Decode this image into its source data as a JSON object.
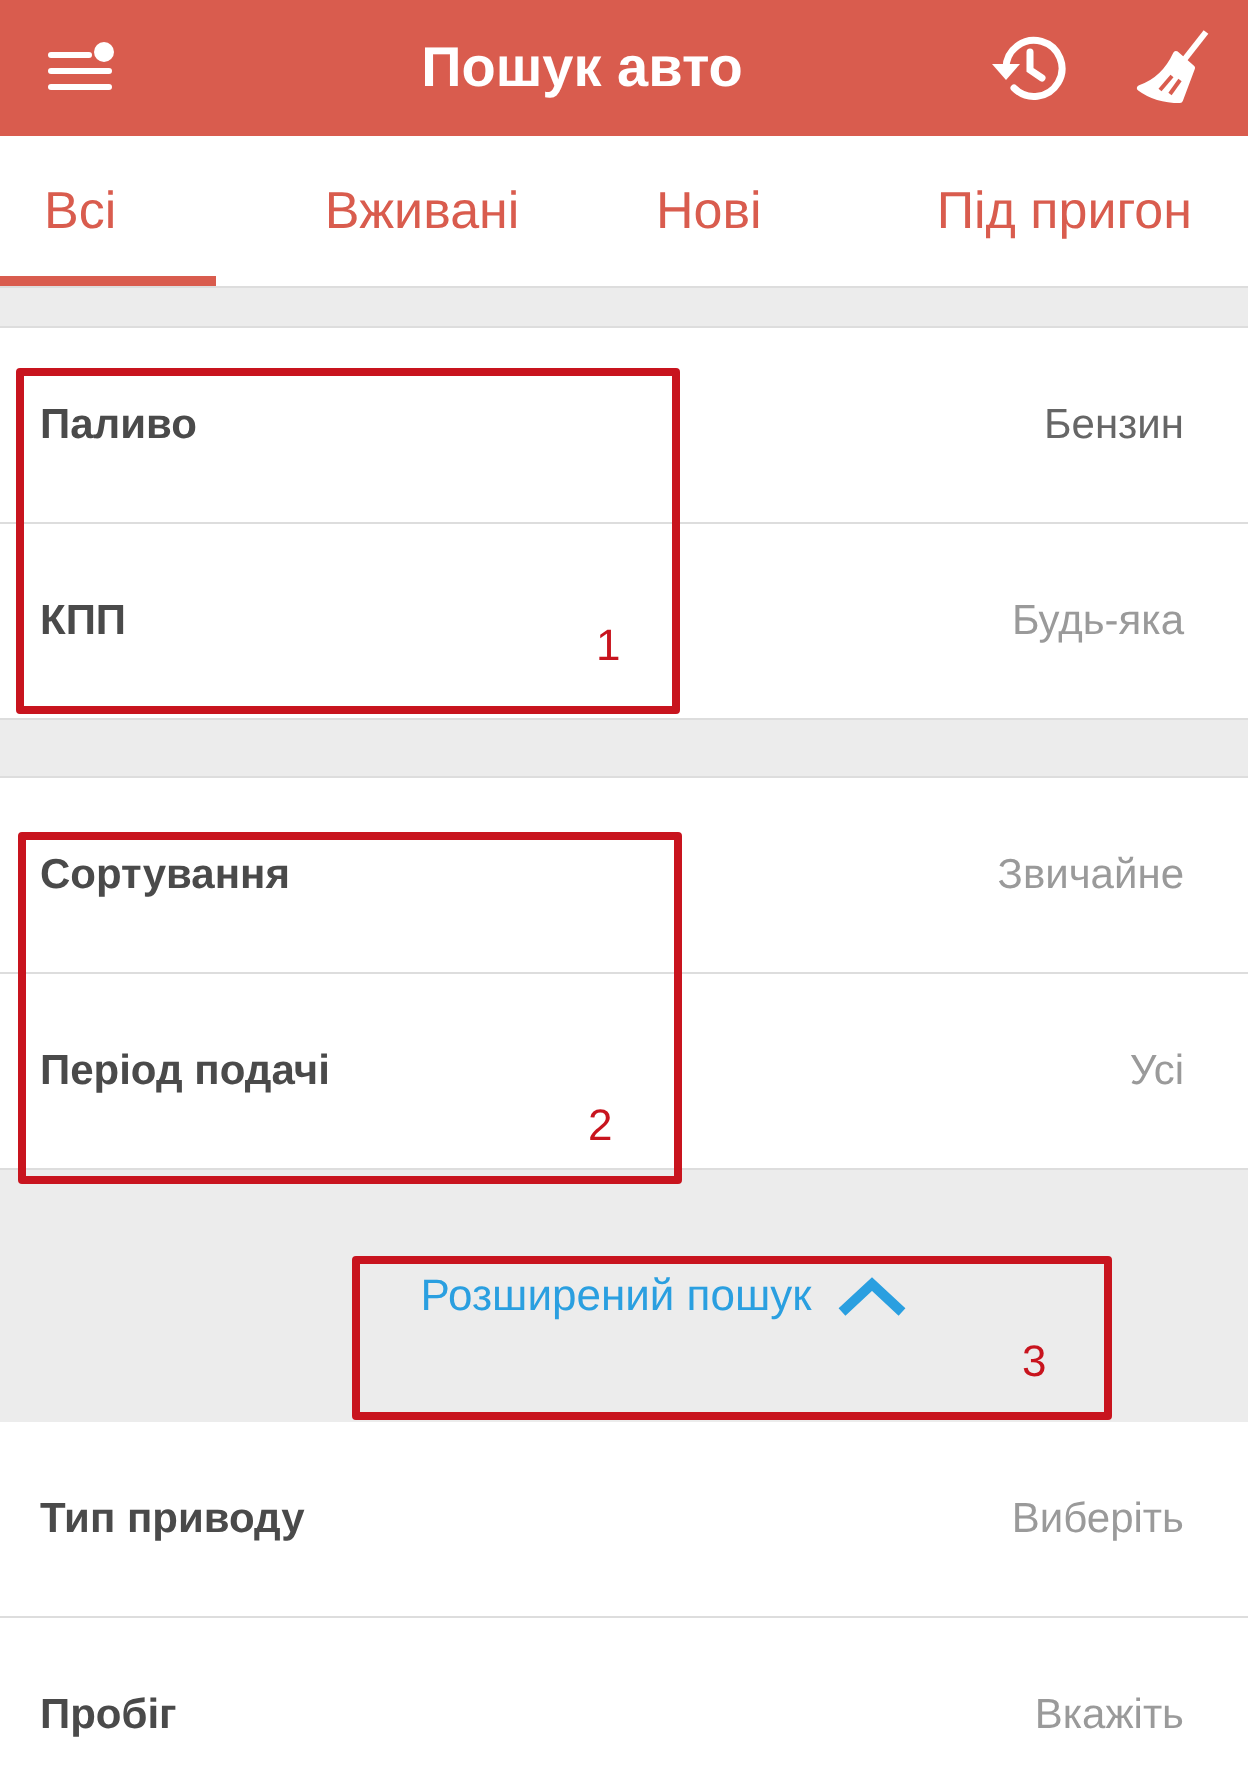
{
  "header": {
    "title": "Пошук авто"
  },
  "tabs": [
    {
      "label": "Всі",
      "selected": true
    },
    {
      "label": "Вживані",
      "selected": false
    },
    {
      "label": "Нові",
      "selected": false
    },
    {
      "label": "Під пригон",
      "selected": false
    }
  ],
  "sections": [
    {
      "rows": [
        {
          "label": "Паливо",
          "value": "Бензин",
          "chosen": true
        },
        {
          "label": "КПП",
          "value": "Будь-яка",
          "chosen": false
        }
      ]
    },
    {
      "rows": [
        {
          "label": "Сортування",
          "value": "Звичайне",
          "chosen": false
        },
        {
          "label": "Період подачі",
          "value": "Усі",
          "chosen": false
        }
      ]
    }
  ],
  "advanced_toggle": {
    "label": "Розширений пошук",
    "expanded": true
  },
  "advanced_rows": [
    {
      "label": "Тип приводу",
      "value": "Виберіть",
      "chosen": false
    },
    {
      "label": "Пробіг",
      "value": "Вкажіть",
      "chosen": false
    }
  ],
  "annotations": [
    {
      "label": "1"
    },
    {
      "label": "2"
    },
    {
      "label": "3"
    }
  ]
}
